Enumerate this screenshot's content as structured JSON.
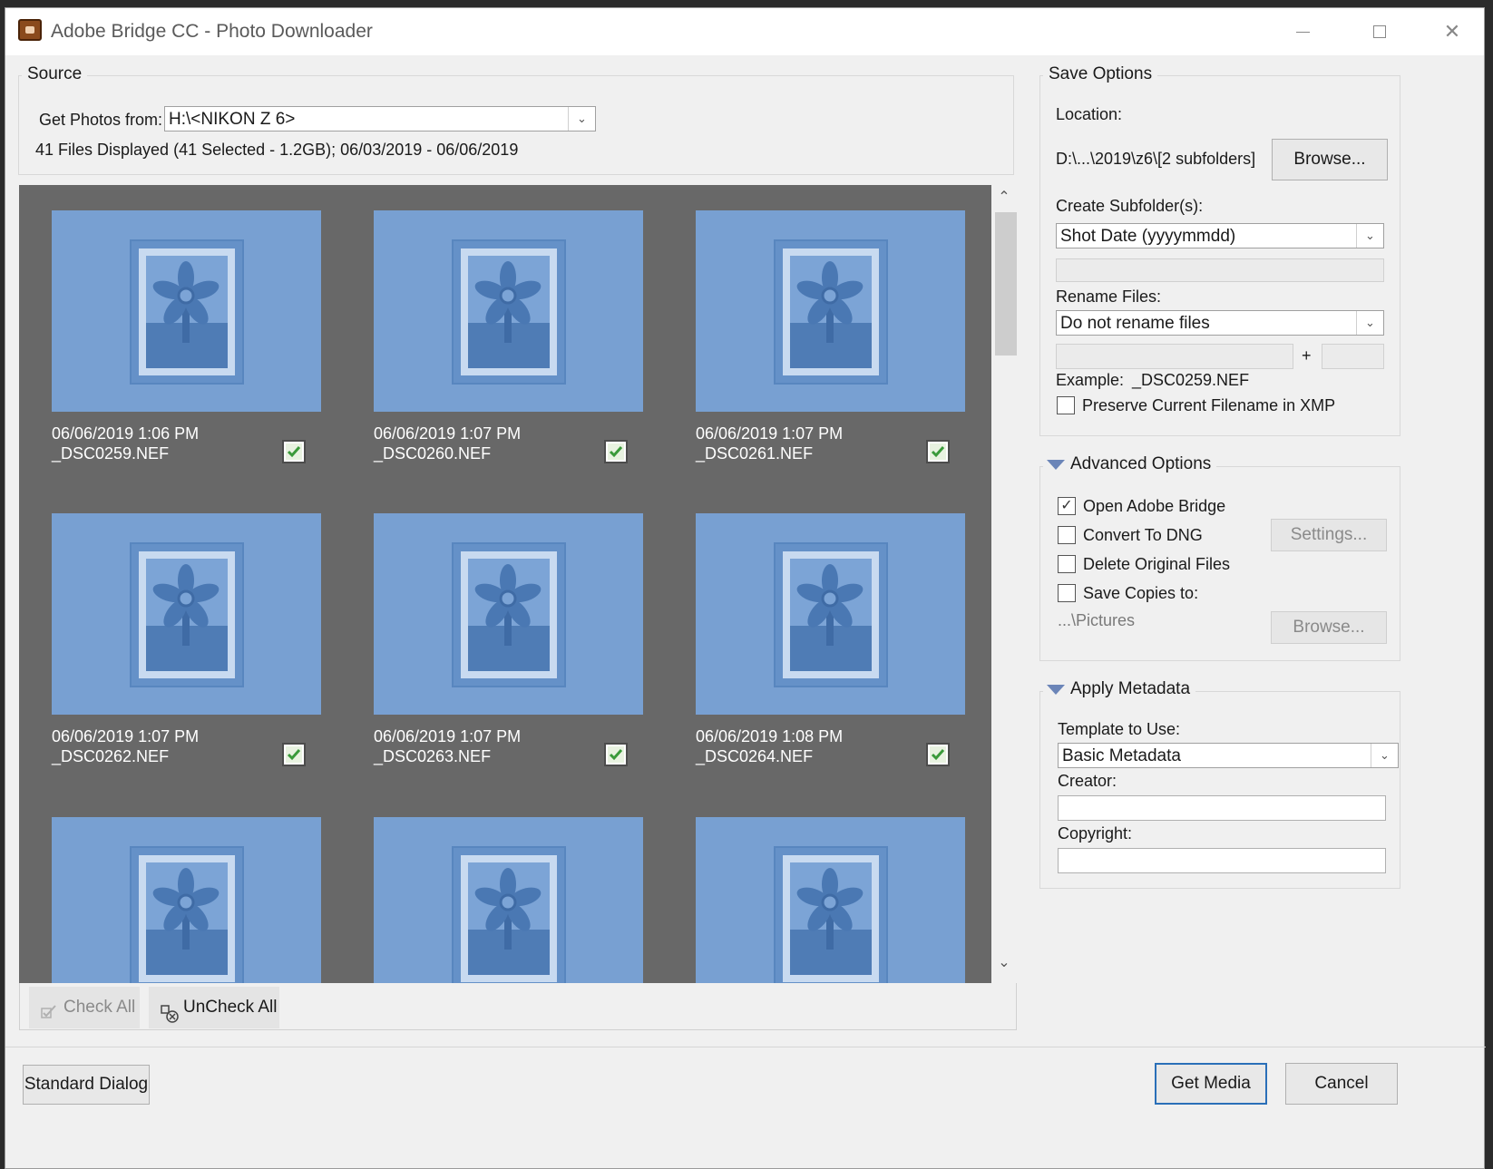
{
  "window": {
    "title": "Adobe Bridge CC - Photo Downloader",
    "minimize_glyph": "—",
    "maximize_glyph": "☐",
    "close_glyph": "✕"
  },
  "source": {
    "group_label": "Source",
    "get_photos_label": "Get Photos from:",
    "get_photos_value": "H:\\<NIKON Z 6>",
    "summary": "41 Files Displayed (41 Selected - 1.2GB); 06/03/2019 - 06/06/2019"
  },
  "thumbnails": [
    {
      "datetime": "06/06/2019 1:06 PM",
      "filename": "_DSC0259.NEF",
      "checked": true
    },
    {
      "datetime": "06/06/2019 1:07 PM",
      "filename": "_DSC0260.NEF",
      "checked": true
    },
    {
      "datetime": "06/06/2019 1:07 PM",
      "filename": "_DSC0261.NEF",
      "checked": true
    },
    {
      "datetime": "06/06/2019 1:07 PM",
      "filename": "_DSC0262.NEF",
      "checked": true
    },
    {
      "datetime": "06/06/2019 1:07 PM",
      "filename": "_DSC0263.NEF",
      "checked": true
    },
    {
      "datetime": "06/06/2019 1:08 PM",
      "filename": "_DSC0264.NEF",
      "checked": true
    },
    {
      "datetime": "",
      "filename": "",
      "checked": true
    },
    {
      "datetime": "",
      "filename": "",
      "checked": true
    },
    {
      "datetime": "",
      "filename": "",
      "checked": true
    }
  ],
  "grid_toolbar": {
    "check_all": "Check All",
    "uncheck_all": "UnCheck All"
  },
  "save_options": {
    "group_label": "Save Options",
    "location_label": "Location:",
    "location_value": "D:\\...\\2019\\z6\\[2 subfolders]",
    "browse_label": "Browse...",
    "subfolder_label": "Create Subfolder(s):",
    "subfolder_value": "Shot Date (yyyymmdd)",
    "rename_label": "Rename Files:",
    "rename_value": "Do not rename files",
    "plus_sign": "+",
    "example_label": "Example:",
    "example_value": "_DSC0259.NEF",
    "preserve_label": "Preserve Current Filename in XMP",
    "preserve_checked": false
  },
  "advanced_options": {
    "group_label": "Advanced Options",
    "open_bridge_label": "Open Adobe Bridge",
    "open_bridge_checked": true,
    "convert_dng_label": "Convert To DNG",
    "convert_dng_checked": false,
    "settings_label": "Settings...",
    "delete_label": "Delete Original Files",
    "delete_checked": false,
    "save_copies_label": "Save Copies to:",
    "save_copies_checked": false,
    "copies_path": "...\\Pictures",
    "browse_label": "Browse..."
  },
  "apply_metadata": {
    "group_label": "Apply Metadata",
    "template_label": "Template to Use:",
    "template_value": "Basic Metadata",
    "creator_label": "Creator:",
    "creator_value": "",
    "copyright_label": "Copyright:",
    "copyright_value": ""
  },
  "footer": {
    "standard_dialog": "Standard Dialog",
    "get_media": "Get Media",
    "cancel": "Cancel"
  },
  "colors": {
    "thumb_bg": "#78a0d2",
    "grid_bg": "#686868",
    "check_green": "#3a9a3a",
    "section_triangle": "#6b85b8",
    "default_button_border": "#2a6fb8"
  },
  "icons": {
    "dropdown": "chevron-down-icon",
    "scroll_up": "chevron-up-icon",
    "scroll_down": "chevron-down-icon",
    "thumbnail_placeholder": "image-placeholder-icon",
    "check_all": "check-all-icon",
    "uncheck_all": "uncheck-all-icon"
  }
}
